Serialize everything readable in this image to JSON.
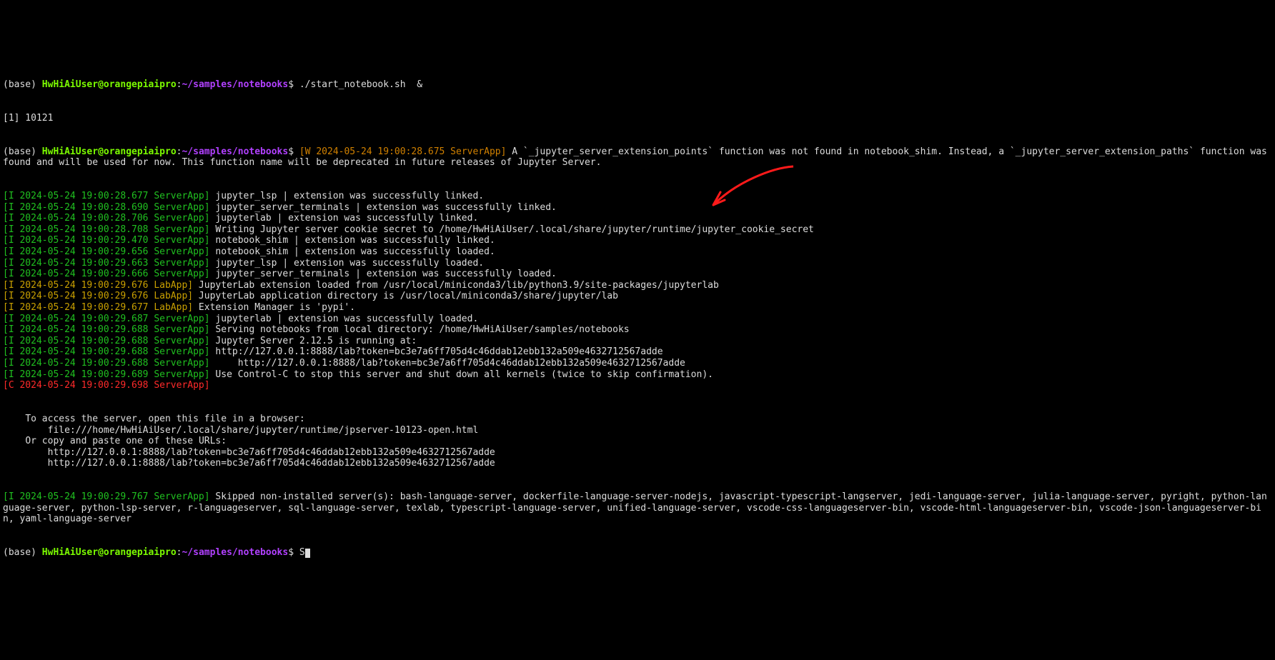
{
  "prompt": {
    "base": "(base) ",
    "user": "HwHiAiUser",
    "at": "@",
    "host": "orangepiaipro",
    "colon": ":",
    "path": "~/samples/notebooks",
    "dollar": "$ "
  },
  "cmd1": "./start_notebook.sh  &",
  "bgjob": "[1] 10121",
  "warn_tag": "[W 2024-05-24 19:00:28.675 ServerApp]",
  "warn_msg": " A `_jupyter_server_extension_points` function was not found in notebook_shim. Instead, a `_jupyter_server_extension_paths` function was found and will be used for now. This function name will be deprecated in future releases of Jupyter Server.",
  "lines": [
    {
      "tag": "[I 2024-05-24 19:00:28.677 ServerApp]",
      "cls": "info",
      "msg": " jupyter_lsp | extension was successfully linked."
    },
    {
      "tag": "[I 2024-05-24 19:00:28.690 ServerApp]",
      "cls": "info",
      "msg": " jupyter_server_terminals | extension was successfully linked."
    },
    {
      "tag": "[I 2024-05-24 19:00:28.706 ServerApp]",
      "cls": "info",
      "msg": " jupyterlab | extension was successfully linked."
    },
    {
      "tag": "[I 2024-05-24 19:00:28.708 ServerApp]",
      "cls": "info",
      "msg": " Writing Jupyter server cookie secret to /home/HwHiAiUser/.local/share/jupyter/runtime/jupyter_cookie_secret"
    },
    {
      "tag": "[I 2024-05-24 19:00:29.470 ServerApp]",
      "cls": "info",
      "msg": " notebook_shim | extension was successfully linked."
    },
    {
      "tag": "[I 2024-05-24 19:00:29.656 ServerApp]",
      "cls": "info",
      "msg": " notebook_shim | extension was successfully loaded."
    },
    {
      "tag": "[I 2024-05-24 19:00:29.663 ServerApp]",
      "cls": "info",
      "msg": " jupyter_lsp | extension was successfully loaded."
    },
    {
      "tag": "[I 2024-05-24 19:00:29.666 ServerApp]",
      "cls": "info",
      "msg": " jupyter_server_terminals | extension was successfully loaded."
    },
    {
      "tag": "[I 2024-05-24 19:00:29.676 LabApp]",
      "cls": "lab",
      "msg": " JupyterLab extension loaded from /usr/local/miniconda3/lib/python3.9/site-packages/jupyterlab"
    },
    {
      "tag": "[I 2024-05-24 19:00:29.676 LabApp]",
      "cls": "lab",
      "msg": " JupyterLab application directory is /usr/local/miniconda3/share/jupyter/lab"
    },
    {
      "tag": "[I 2024-05-24 19:00:29.677 LabApp]",
      "cls": "lab",
      "msg": " Extension Manager is 'pypi'."
    },
    {
      "tag": "[I 2024-05-24 19:00:29.687 ServerApp]",
      "cls": "info",
      "msg": " jupyterlab | extension was successfully loaded."
    },
    {
      "tag": "[I 2024-05-24 19:00:29.688 ServerApp]",
      "cls": "info",
      "msg": " Serving notebooks from local directory: /home/HwHiAiUser/samples/notebooks"
    },
    {
      "tag": "[I 2024-05-24 19:00:29.688 ServerApp]",
      "cls": "info",
      "msg": " Jupyter Server 2.12.5 is running at:"
    },
    {
      "tag": "[I 2024-05-24 19:00:29.688 ServerApp]",
      "cls": "info",
      "msg": " http://127.0.0.1:8888/lab?token=bc3e7a6ff705d4c46ddab12ebb132a509e4632712567adde"
    },
    {
      "tag": "[I 2024-05-24 19:00:29.688 ServerApp]",
      "cls": "info",
      "msg": "     http://127.0.0.1:8888/lab?token=bc3e7a6ff705d4c46ddab12ebb132a509e4632712567adde"
    },
    {
      "tag": "[I 2024-05-24 19:00:29.689 ServerApp]",
      "cls": "info",
      "msg": " Use Control-C to stop this server and shut down all kernels (twice to skip confirmation)."
    },
    {
      "tag": "[C 2024-05-24 19:00:29.698 ServerApp]",
      "cls": "crit",
      "msg": ""
    }
  ],
  "access_block": [
    "",
    "    To access the server, open this file in a browser:",
    "        file:///home/HwHiAiUser/.local/share/jupyter/runtime/jpserver-10123-open.html",
    "    Or copy and paste one of these URLs:",
    "        http://127.0.0.1:8888/lab?token=bc3e7a6ff705d4c46ddab12ebb132a509e4632712567adde",
    "        http://127.0.0.1:8888/lab?token=bc3e7a6ff705d4c46ddab12ebb132a509e4632712567adde"
  ],
  "skipped_tag": "[I 2024-05-24 19:00:29.767 ServerApp]",
  "skipped_msg": " Skipped non-installed server(s): bash-language-server, dockerfile-language-server-nodejs, javascript-typescript-langserver, jedi-language-server, julia-language-server, pyright, python-language-server, python-lsp-server, r-languageserver, sql-language-server, texlab, typescript-language-server, unified-language-server, vscode-css-languageserver-bin, vscode-html-languageserver-bin, vscode-json-languageserver-bin, yaml-language-server",
  "cmd2": "S",
  "arrow": {
    "color": "#ff1a1a"
  }
}
